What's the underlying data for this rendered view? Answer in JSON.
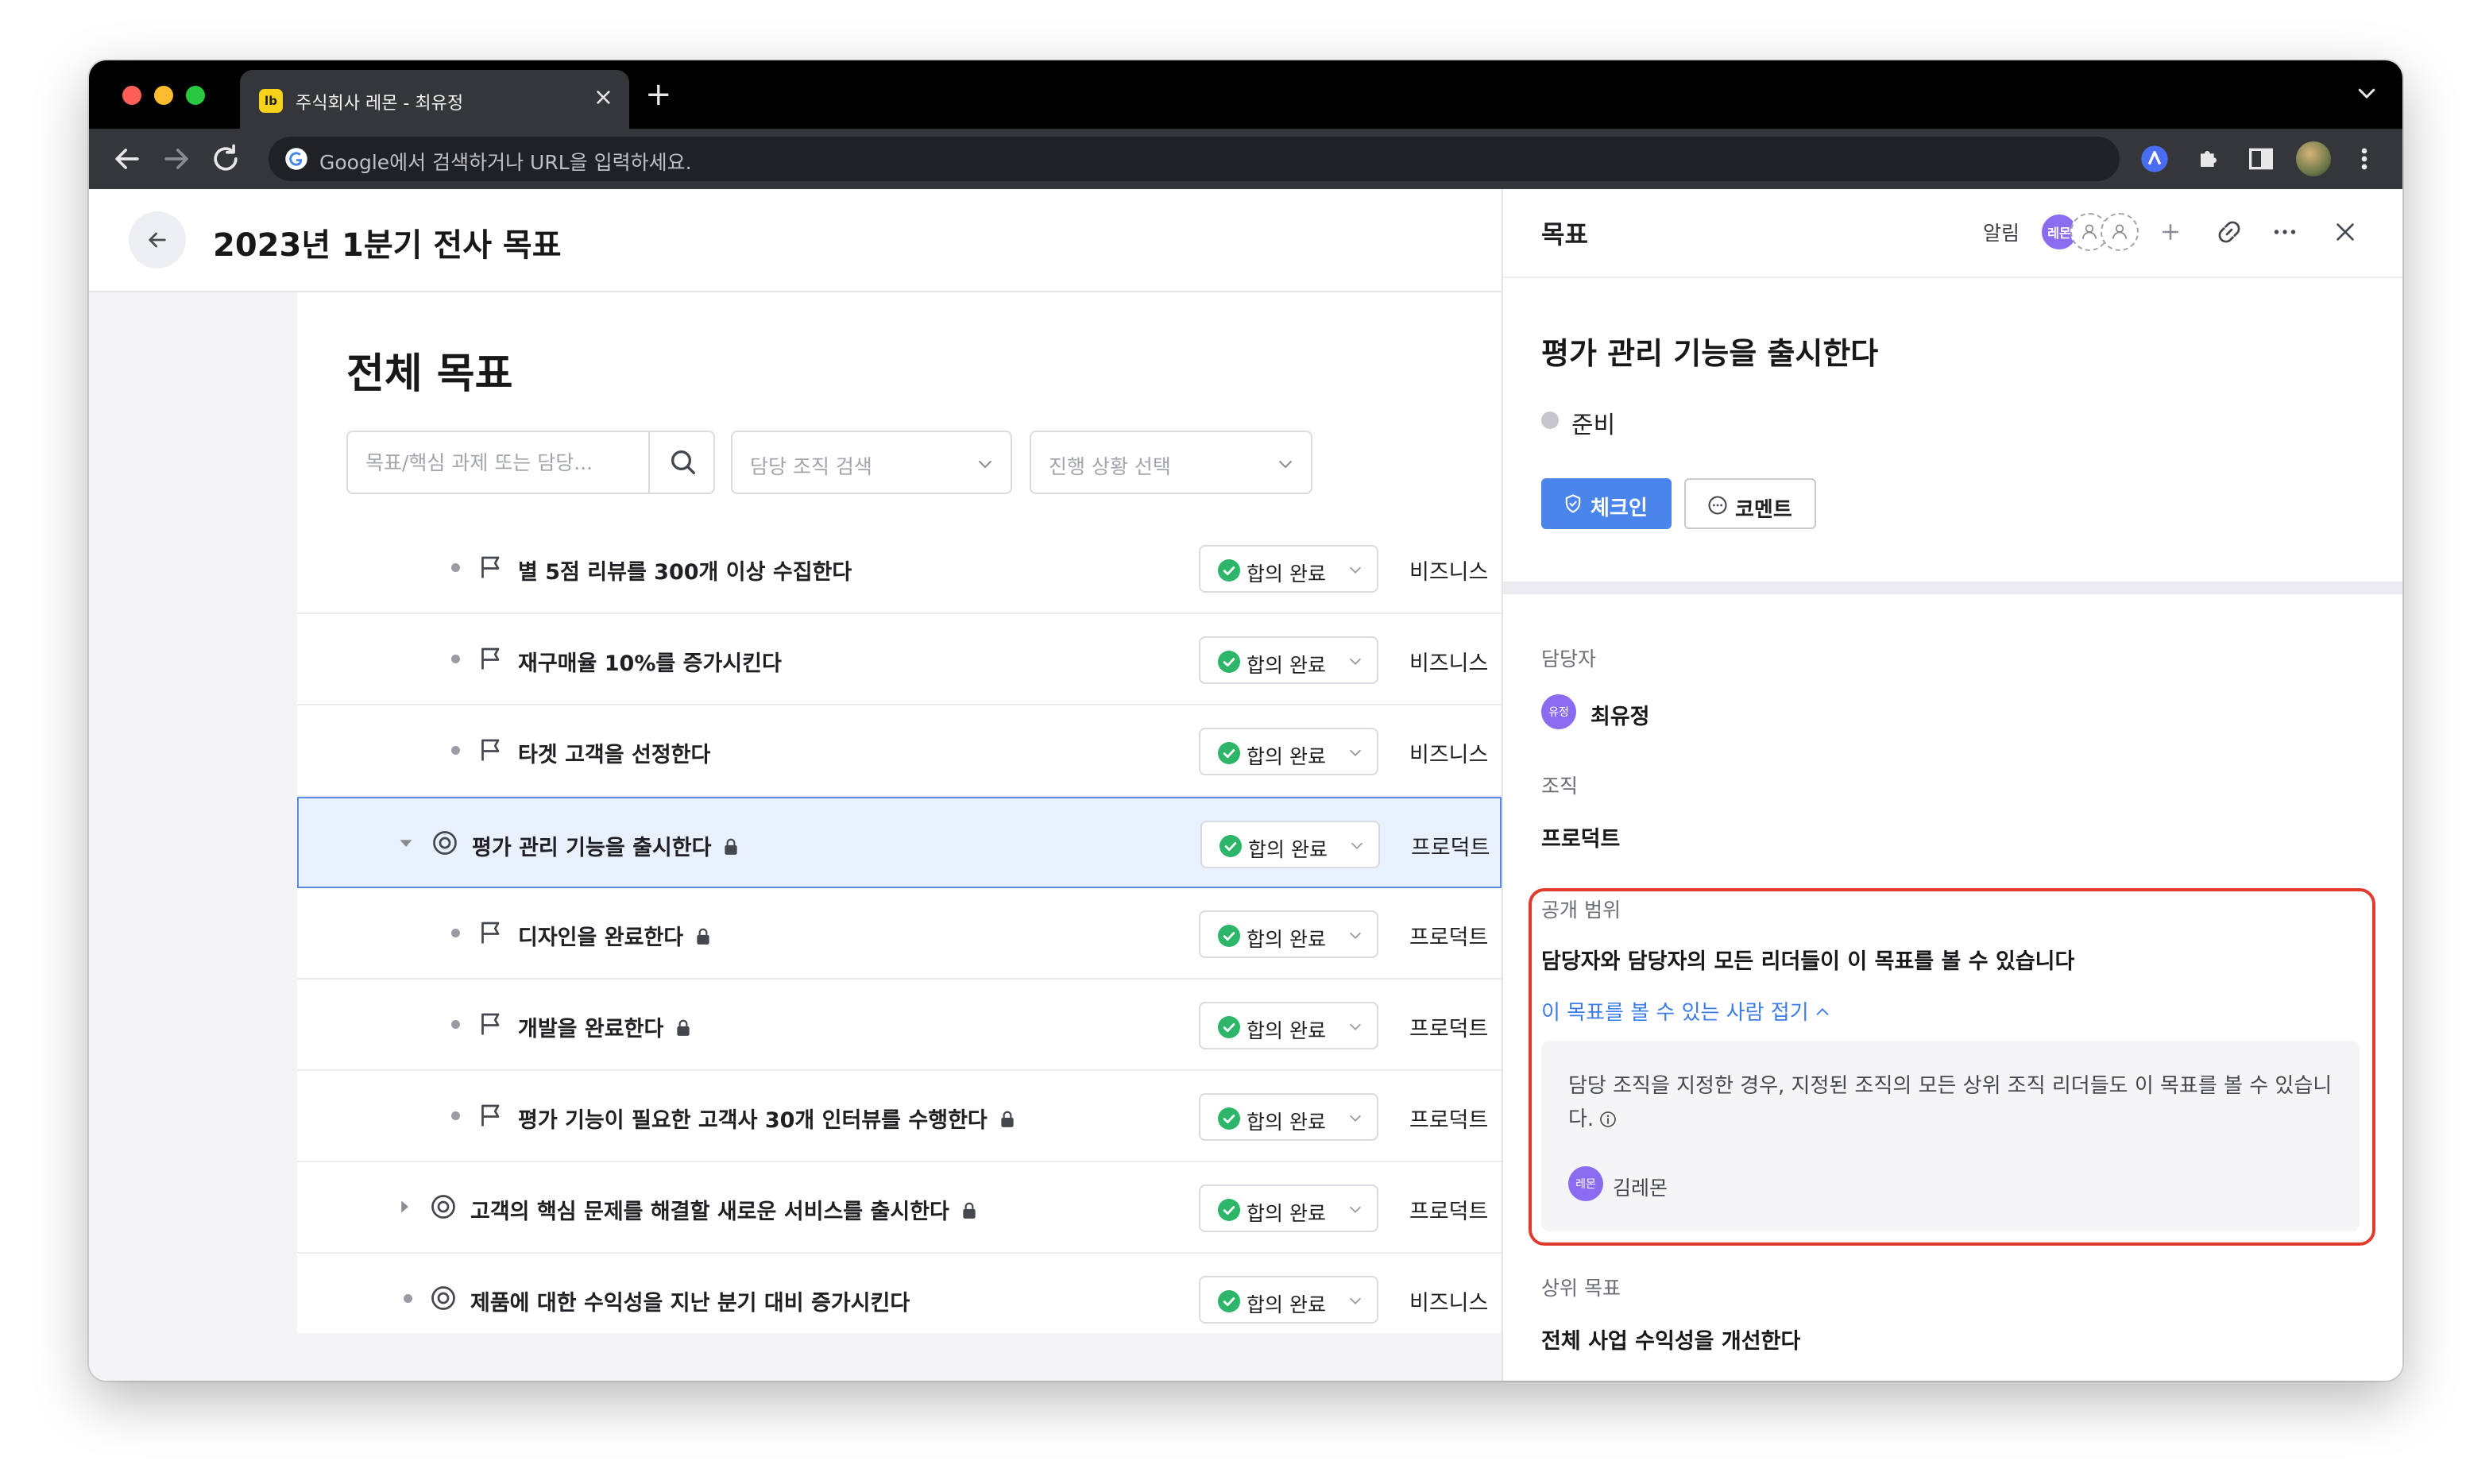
{
  "browser": {
    "tab_favicon": "lb",
    "tab_title": "주식회사 레몬 - 최유정",
    "tab_close": "×",
    "new_tab": "+",
    "omnibox_placeholder": "Google에서 검색하거나 URL을 입력하세요."
  },
  "header": {
    "page_title": "2023년 1분기 전사 목표"
  },
  "main": {
    "section_title": "전체 목표",
    "search_placeholder": "목표/핵심 과제 또는 담당...",
    "org_select": "담당 조직 검색",
    "progress_select": "진행 상황 선택",
    "rows": [
      {
        "label": "별 5점 리뷰를 300개 이상 수집한다",
        "status": "합의 완료",
        "org": "비즈니스",
        "type": "flag",
        "locked": false
      },
      {
        "label": "재구매율 10%를 증가시킨다",
        "status": "합의 완료",
        "org": "비즈니스",
        "type": "flag",
        "locked": false
      },
      {
        "label": "타겟 고객을 선정한다",
        "status": "합의 완료",
        "org": "비즈니스",
        "type": "flag",
        "locked": false
      },
      {
        "label": "평가 관리 기능을 출시한다",
        "status": "합의 완료",
        "org": "프로덕트",
        "type": "goal",
        "locked": true
      },
      {
        "label": "디자인을 완료한다",
        "status": "합의 완료",
        "org": "프로덕트",
        "type": "flag",
        "locked": true
      },
      {
        "label": "개발을 완료한다",
        "status": "합의 완료",
        "org": "프로덕트",
        "type": "flag",
        "locked": true
      },
      {
        "label": "평가 기능이 필요한 고객사 30개 인터뷰를 수행한다",
        "status": "합의 완료",
        "org": "프로덕트",
        "type": "flag",
        "locked": true
      },
      {
        "label": "고객의 핵심 문제를 해결할 새로운 서비스를 출시한다",
        "status": "합의 완료",
        "org": "프로덕트",
        "type": "goal",
        "locked": true
      },
      {
        "label": "제품에 대한 수익성을 지난 분기 대비 증가시킨다",
        "status": "합의 완료",
        "org": "비즈니스",
        "type": "goal",
        "locked": false
      }
    ]
  },
  "panel": {
    "title": "목표",
    "alert_label": "알림",
    "header_avatar": "레몬",
    "goal_title": "평가 관리 기능을 출시한다",
    "state": "준비",
    "checkin_label": "체크인",
    "comment_label": "코멘트",
    "owner_label": "담당자",
    "owner_avatar": "유정",
    "owner_name": "최유정",
    "org_label": "조직",
    "org_value": "프로덕트",
    "visibility_label": "공개 범위",
    "visibility_value": "담당자와 담당자의 모든 리더들이 이 목표를 볼 수 있습니다",
    "collapse_link": "이 목표를 볼 수 있는 사람 접기",
    "info_text": "담당 조직을 지정한 경우, 지정된 조직의 모든 상위 조직 리더들도 이 목표를 볼 수 있습니다.",
    "leader_avatar": "레몬",
    "leader_name": "김레몬",
    "parent_label": "상위 목표",
    "parent_value": "전체 사업 수익성을 개선한다"
  },
  "colors": {
    "accent": "#4a85ec",
    "status_done": "#2db56a",
    "highlight": "#e23a2c",
    "avatar": "#8b6cf0"
  }
}
